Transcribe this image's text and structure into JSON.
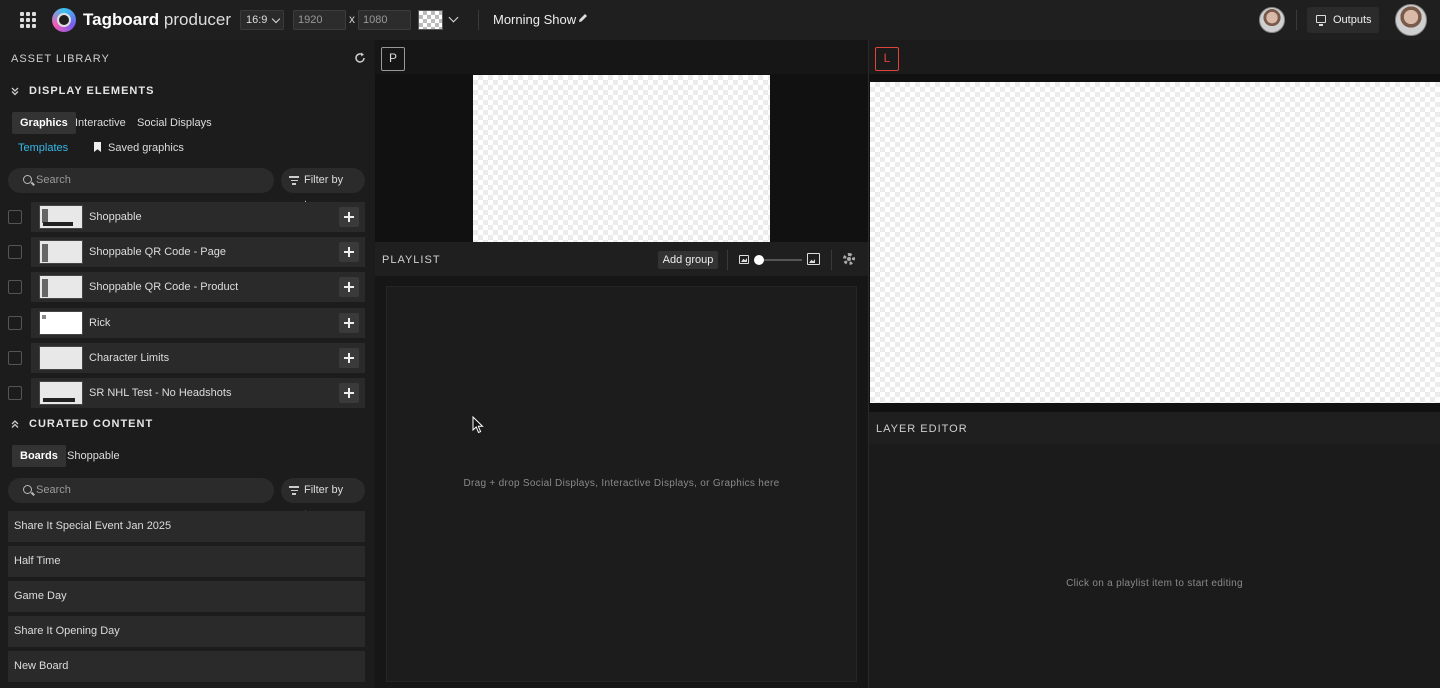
{
  "topbar": {
    "brand_bold": "Tagboard",
    "brand_light": "producer",
    "aspect_ratio": "16:9",
    "width_value": "1920",
    "height_value": "1080",
    "dim_separator": "x",
    "show_name": "Morning Show",
    "outputs_label": "Outputs"
  },
  "left": {
    "asset_library_title": "ASSET LIBRARY",
    "display_elements_title": "DISPLAY ELEMENTS",
    "display_tabs": [
      "Graphics",
      "Interactive",
      "Social Displays"
    ],
    "sub_tabs": [
      "Templates",
      "Saved graphics"
    ],
    "search_placeholder": "Search",
    "filter_label": "Filter by tags",
    "assets": [
      {
        "name": "Shoppable"
      },
      {
        "name": "Shoppable QR Code - Page"
      },
      {
        "name": "Shoppable QR Code - Product"
      },
      {
        "name": "Rick"
      },
      {
        "name": "Character Limits"
      },
      {
        "name": "SR NHL Test - No Headshots"
      }
    ],
    "curated_title": "CURATED CONTENT",
    "curated_tabs": [
      "Boards",
      "Shoppable"
    ],
    "boards": [
      {
        "name": "Share It Special Event Jan 2025"
      },
      {
        "name": "Half Time"
      },
      {
        "name": "Game Day"
      },
      {
        "name": "Share It Opening Day"
      },
      {
        "name": "New Board"
      }
    ]
  },
  "middle": {
    "preview_label": "P",
    "playlist_title": "PLAYLIST",
    "add_group_label": "Add group",
    "drop_hint": "Drag + drop Social Displays, Interactive Displays, or Graphics here"
  },
  "right": {
    "live_label": "L",
    "layer_editor_title": "LAYER EDITOR",
    "layer_hint": "Click on a playlist item to start editing"
  },
  "colors": {
    "accent_blue": "#37b8e8",
    "live_red": "#e0453a",
    "background": "#1b1b1b"
  }
}
